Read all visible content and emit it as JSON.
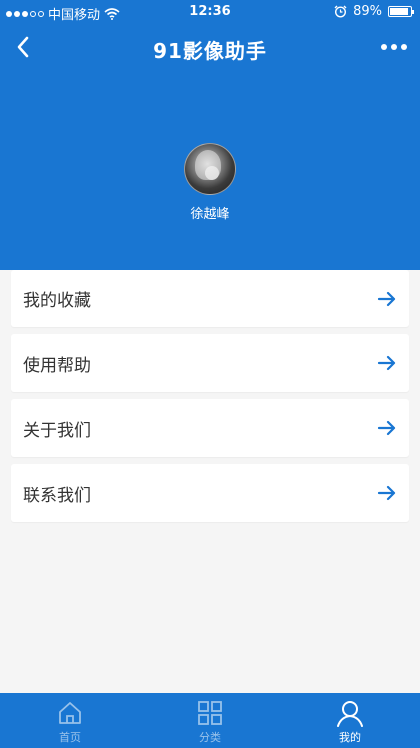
{
  "status_bar": {
    "carrier": "中国移动",
    "time": "12:36",
    "battery_text": "89%",
    "battery_level": 0.89
  },
  "nav": {
    "title": "91影像助手",
    "back_icon": "chevron-left-icon",
    "more_icon": "more-horizontal-icon"
  },
  "profile": {
    "username": "徐越峰"
  },
  "menu": {
    "items": [
      {
        "label": "我的收藏"
      },
      {
        "label": "使用帮助"
      },
      {
        "label": "关于我们"
      },
      {
        "label": "联系我们"
      }
    ]
  },
  "tab_bar": {
    "tabs": [
      {
        "label": "首页",
        "icon": "home-icon",
        "active": false
      },
      {
        "label": "分类",
        "icon": "grid-icon",
        "active": false
      },
      {
        "label": "我的",
        "icon": "user-icon",
        "active": true
      }
    ]
  },
  "colors": {
    "primary": "#1976d2",
    "background": "#f5f5f5",
    "arrow": "#1976d2"
  }
}
